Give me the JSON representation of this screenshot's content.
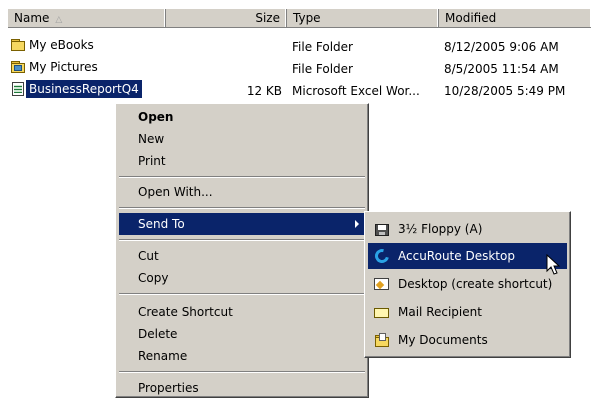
{
  "columns": {
    "name": "Name",
    "size": "Size",
    "type": "Type",
    "modified": "Modified"
  },
  "files": [
    {
      "name": "My eBooks",
      "size": "",
      "type": "File Folder",
      "modified": "8/12/2005 9:06 AM",
      "icon": "folder-icon",
      "selected": false
    },
    {
      "name": "My Pictures",
      "size": "",
      "type": "File Folder",
      "modified": "8/5/2005 11:54 AM",
      "icon": "picture-folder-icon",
      "selected": false
    },
    {
      "name": "BusinessReportQ4",
      "size": "12 KB",
      "type": "Microsoft Excel Wor...",
      "modified": "10/28/2005 5:49 PM",
      "icon": "excel-file-icon",
      "selected": true
    }
  ],
  "context_menu": {
    "open": "Open",
    "new": "New",
    "print": "Print",
    "open_with": "Open With...",
    "send_to": "Send To",
    "cut": "Cut",
    "copy": "Copy",
    "create_shortcut": "Create Shortcut",
    "delete": "Delete",
    "rename": "Rename",
    "properties": "Properties"
  },
  "send_to_menu": {
    "floppy": "3½ Floppy (A)",
    "accuroute": "AccuRoute Desktop",
    "desktop": "Desktop (create shortcut)",
    "mail": "Mail Recipient",
    "my_documents": "My Documents"
  },
  "colors": {
    "selection": "#0a246a",
    "menu_bg": "#d4d0c8"
  }
}
